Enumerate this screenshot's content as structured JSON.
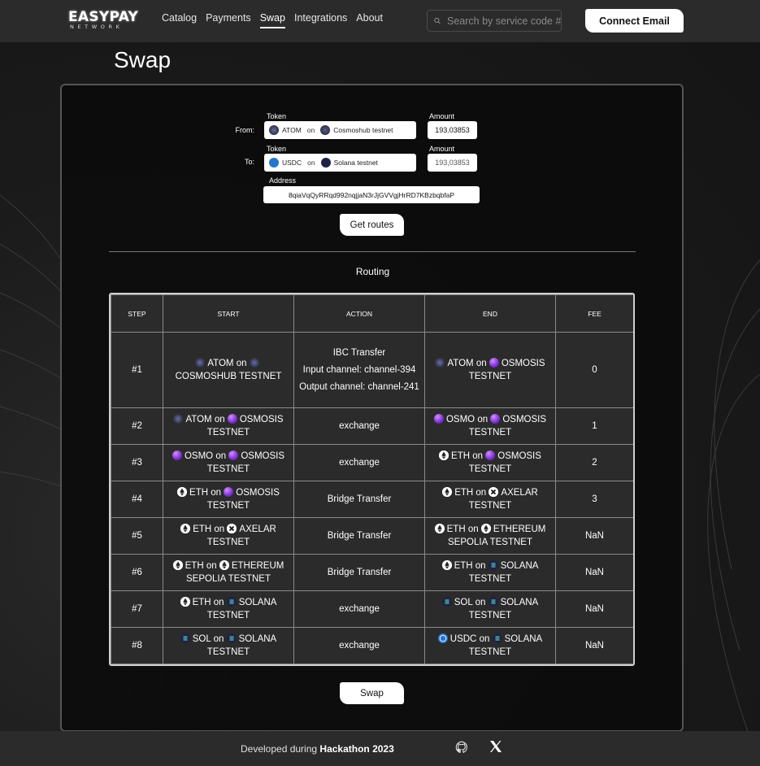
{
  "header": {
    "logo_main": "EASYPAY",
    "logo_sub": "NETWORK",
    "nav": [
      "Catalog",
      "Payments",
      "Swap",
      "Integrations",
      "About"
    ],
    "active_nav": "Swap",
    "search_placeholder": "Search by service code #",
    "connect_label": "Connect Email"
  },
  "page_title": "Swap",
  "form": {
    "from_label": "From:",
    "to_label": "To:",
    "token_label": "Token",
    "amount_label": "Amount",
    "address_label": "Address",
    "from_token": "ATOM",
    "from_chain": "Cosmoshub testnet",
    "from_amount": "193.03853",
    "to_token": "USDC",
    "to_chain": "Solana testnet",
    "to_amount": "193,03853",
    "on_word": "on",
    "address": "8qiaVqQyRRqd992nqjjaN3rJjGVVgjHrRD7KBzbqbfaP",
    "get_routes_label": "Get routes"
  },
  "routing": {
    "title": "Routing",
    "headers": [
      "STEP",
      "START",
      "ACTION",
      "END",
      "FEE"
    ],
    "rows": [
      {
        "step": "#1",
        "start_token": "ATOM",
        "start_chain": "COSMOSHUB TESTNET",
        "action_lines": [
          "IBC Transfer",
          "Input channel: channel-394",
          "Output channel: channel-241"
        ],
        "end_token": "ATOM",
        "end_chain": "OSMOSIS TESTNET",
        "fee": "0"
      },
      {
        "step": "#2",
        "start_token": "ATOM",
        "start_chain": "OSMOSIS TESTNET",
        "action": "exchange",
        "end_token": "OSMO",
        "end_chain": "OSMOSIS TESTNET",
        "fee": "1"
      },
      {
        "step": "#3",
        "start_token": "OSMO",
        "start_chain": "OSMOSIS TESTNET",
        "action": "exchange",
        "end_token": "ETH",
        "end_chain": "OSMOSIS TESTNET",
        "fee": "2"
      },
      {
        "step": "#4",
        "start_token": "ETH",
        "start_chain": "OSMOSIS TESTNET",
        "action": "Bridge Transfer",
        "end_token": "ETH",
        "end_chain": "AXELAR TESTNET",
        "fee": "3"
      },
      {
        "step": "#5",
        "start_token": "ETH",
        "start_chain": "AXELAR TESTNET",
        "action": "Bridge Transfer",
        "end_token": "ETH",
        "end_chain": "ETHEREUM SEPOLIA TESTNET",
        "fee": "NaN"
      },
      {
        "step": "#6",
        "start_token": "ETH",
        "start_chain": "ETHEREUM SEPOLIA TESTNET",
        "action": "Bridge Transfer",
        "end_token": "ETH",
        "end_chain": "SOLANA TESTNET",
        "fee": "NaN"
      },
      {
        "step": "#7",
        "start_token": "ETH",
        "start_chain": "SOLANA TESTNET",
        "action": "exchange",
        "end_token": "SOL",
        "end_chain": "SOLANA TESTNET",
        "fee": "NaN"
      },
      {
        "step": "#8",
        "start_token": "SOL",
        "start_chain": "SOLANA TESTNET",
        "action": "exchange",
        "end_token": "USDC",
        "end_chain": "SOLANA TESTNET",
        "fee": "NaN"
      }
    ],
    "on_word": "on"
  },
  "swap_label": "Swap",
  "footer": {
    "prefix": "Developed during ",
    "highlight": "Hackathon 2023",
    "icons": [
      "github-icon",
      "x-icon"
    ]
  }
}
